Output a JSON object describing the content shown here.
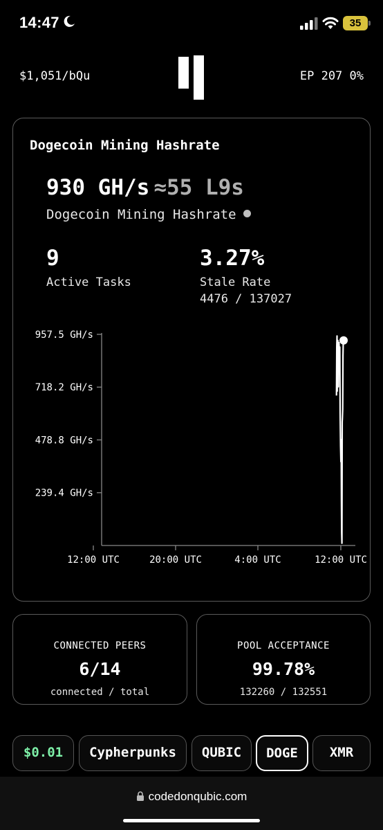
{
  "status_bar": {
    "time": "14:47",
    "battery": "35"
  },
  "header": {
    "price": "$1,051/bQu",
    "ep": "EP 207 0%"
  },
  "hashrate_card": {
    "title": "Dogecoin Mining Hashrate",
    "value": "930 GH/s",
    "approx": "≈55 L9s",
    "subtitle": "Dogecoin Mining Hashrate",
    "active_tasks": {
      "value": "9",
      "label": "Active Tasks"
    },
    "stale_rate": {
      "value": "3.27%",
      "label": "Stale Rate",
      "detail": "4476 / 137027"
    }
  },
  "chart_data": {
    "type": "line",
    "yticks": [
      "239.4 GH/s",
      "478.8 GH/s",
      "718.2 GH/s",
      "957.5 GH/s"
    ],
    "ytick_values": [
      239.4,
      478.8,
      718.2,
      957.5
    ],
    "xticks": [
      "12:00 UTC",
      "20:00 UTC",
      "4:00 UTC",
      "12:00 UTC"
    ],
    "ylim": [
      0,
      957.5
    ],
    "series": [
      {
        "values": [
          [
            0.972,
            680
          ],
          [
            0.973,
            900
          ],
          [
            0.974,
            950
          ],
          [
            0.975,
            700
          ],
          [
            0.976,
            880
          ],
          [
            0.9775,
            930
          ],
          [
            0.979,
            720
          ],
          [
            0.9805,
            900
          ],
          [
            0.982,
            920
          ],
          [
            0.9835,
            820
          ],
          [
            0.985,
            900
          ],
          [
            0.9865,
            600
          ],
          [
            0.988,
            450
          ],
          [
            0.9895,
            380
          ],
          [
            0.9905,
            480
          ],
          [
            0.9915,
            200
          ],
          [
            0.9925,
            60
          ],
          [
            0.9935,
            10
          ],
          [
            0.9945,
            560
          ],
          [
            0.9955,
            580
          ],
          [
            0.9965,
            620
          ],
          [
            0.9975,
            860
          ],
          [
            0.999,
            935
          ],
          [
            1.0,
            930
          ]
        ]
      }
    ],
    "grid": false
  },
  "peers": {
    "title": "CONNECTED PEERS",
    "value": "6/14",
    "sub": "connected / total"
  },
  "pool": {
    "title": "POOL ACCEPTANCE",
    "value": "99.78%",
    "sub": "132260 / 132551"
  },
  "tabs": [
    "$0.01",
    "Cypherpunks",
    "QUBIC",
    "DOGE",
    "XMR"
  ],
  "active_tab": "DOGE",
  "browser": {
    "url": "codedonqubic.com"
  }
}
